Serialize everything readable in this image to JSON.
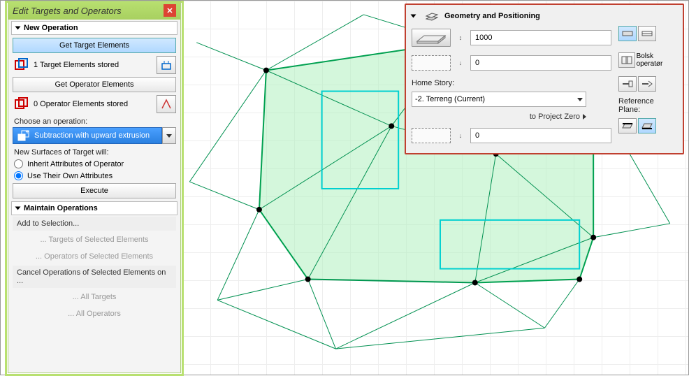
{
  "palette": {
    "title": "Edit Targets and Operators",
    "sections": {
      "new_op": "New Operation",
      "maintain": "Maintain Operations"
    },
    "get_target": "Get Target Elements",
    "target_stored": "1  Target Elements stored",
    "get_operator": "Get Operator Elements",
    "operator_stored": "0  Operator Elements stored",
    "choose_op": "Choose an operation:",
    "op_selected": "Subtraction with upward extrusion",
    "surf_label": "New Surfaces of Target will:",
    "radio_inherit": "Inherit Attributes of Operator",
    "radio_own": "Use Their Own Attributes",
    "execute": "Execute",
    "add_sel": "Add to Selection...",
    "targets_sel": "... Targets of Selected Elements",
    "ops_sel": "... Operators of Selected Elements",
    "cancel_label": "Cancel Operations of Selected Elements on ...",
    "all_targets": "... All Targets",
    "all_ops": "... All Operators"
  },
  "geometry": {
    "title": "Geometry and Positioning",
    "thickness": "1000",
    "elevation": "0",
    "home_story_label": "Home Story:",
    "home_story": "-2. Terreng (Current)",
    "to_project_zero": "to Project Zero",
    "ref_elevation": "0",
    "bolsk": "Bolsk operatør",
    "ref_plane": "Reference Plane:"
  }
}
